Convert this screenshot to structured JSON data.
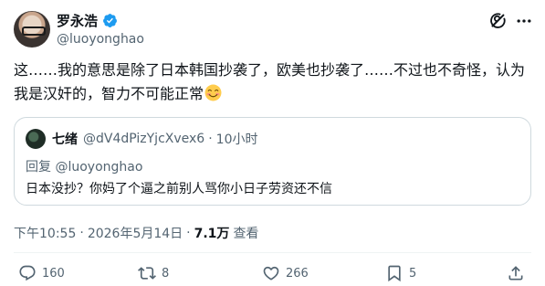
{
  "author": {
    "name": "罗永浩",
    "handle": "@luoyonghao",
    "verified": true
  },
  "tweet": {
    "text": "这……我的意思是除了日本韩国抄袭了，欧美也抄袭了……不过也不奇怪，认为我是汉奸的，智力不可能正常",
    "emoji": "smiling-face-with-smiling-eyes"
  },
  "quote": {
    "name": "七绪",
    "handle": "@dV4dPizYjcXvex6",
    "dot": "·",
    "time": "10小时",
    "reply_label": "回复",
    "reply_handle": "@luoyonghao",
    "text": "日本没抄？你妈了个逼之前别人骂你小日子劳资还不信"
  },
  "meta": {
    "time": "下午10:55",
    "sep": "·",
    "date": "2026年5月14日",
    "views_count": "7.1万",
    "views_label": "查看"
  },
  "actions": {
    "replies": "160",
    "reposts": "8",
    "likes": "266",
    "bookmarks": "5"
  },
  "colors": {
    "text": "#0f1419",
    "secondary": "#536471",
    "border": "#cfd9de",
    "verified": "#1d9bf0"
  }
}
